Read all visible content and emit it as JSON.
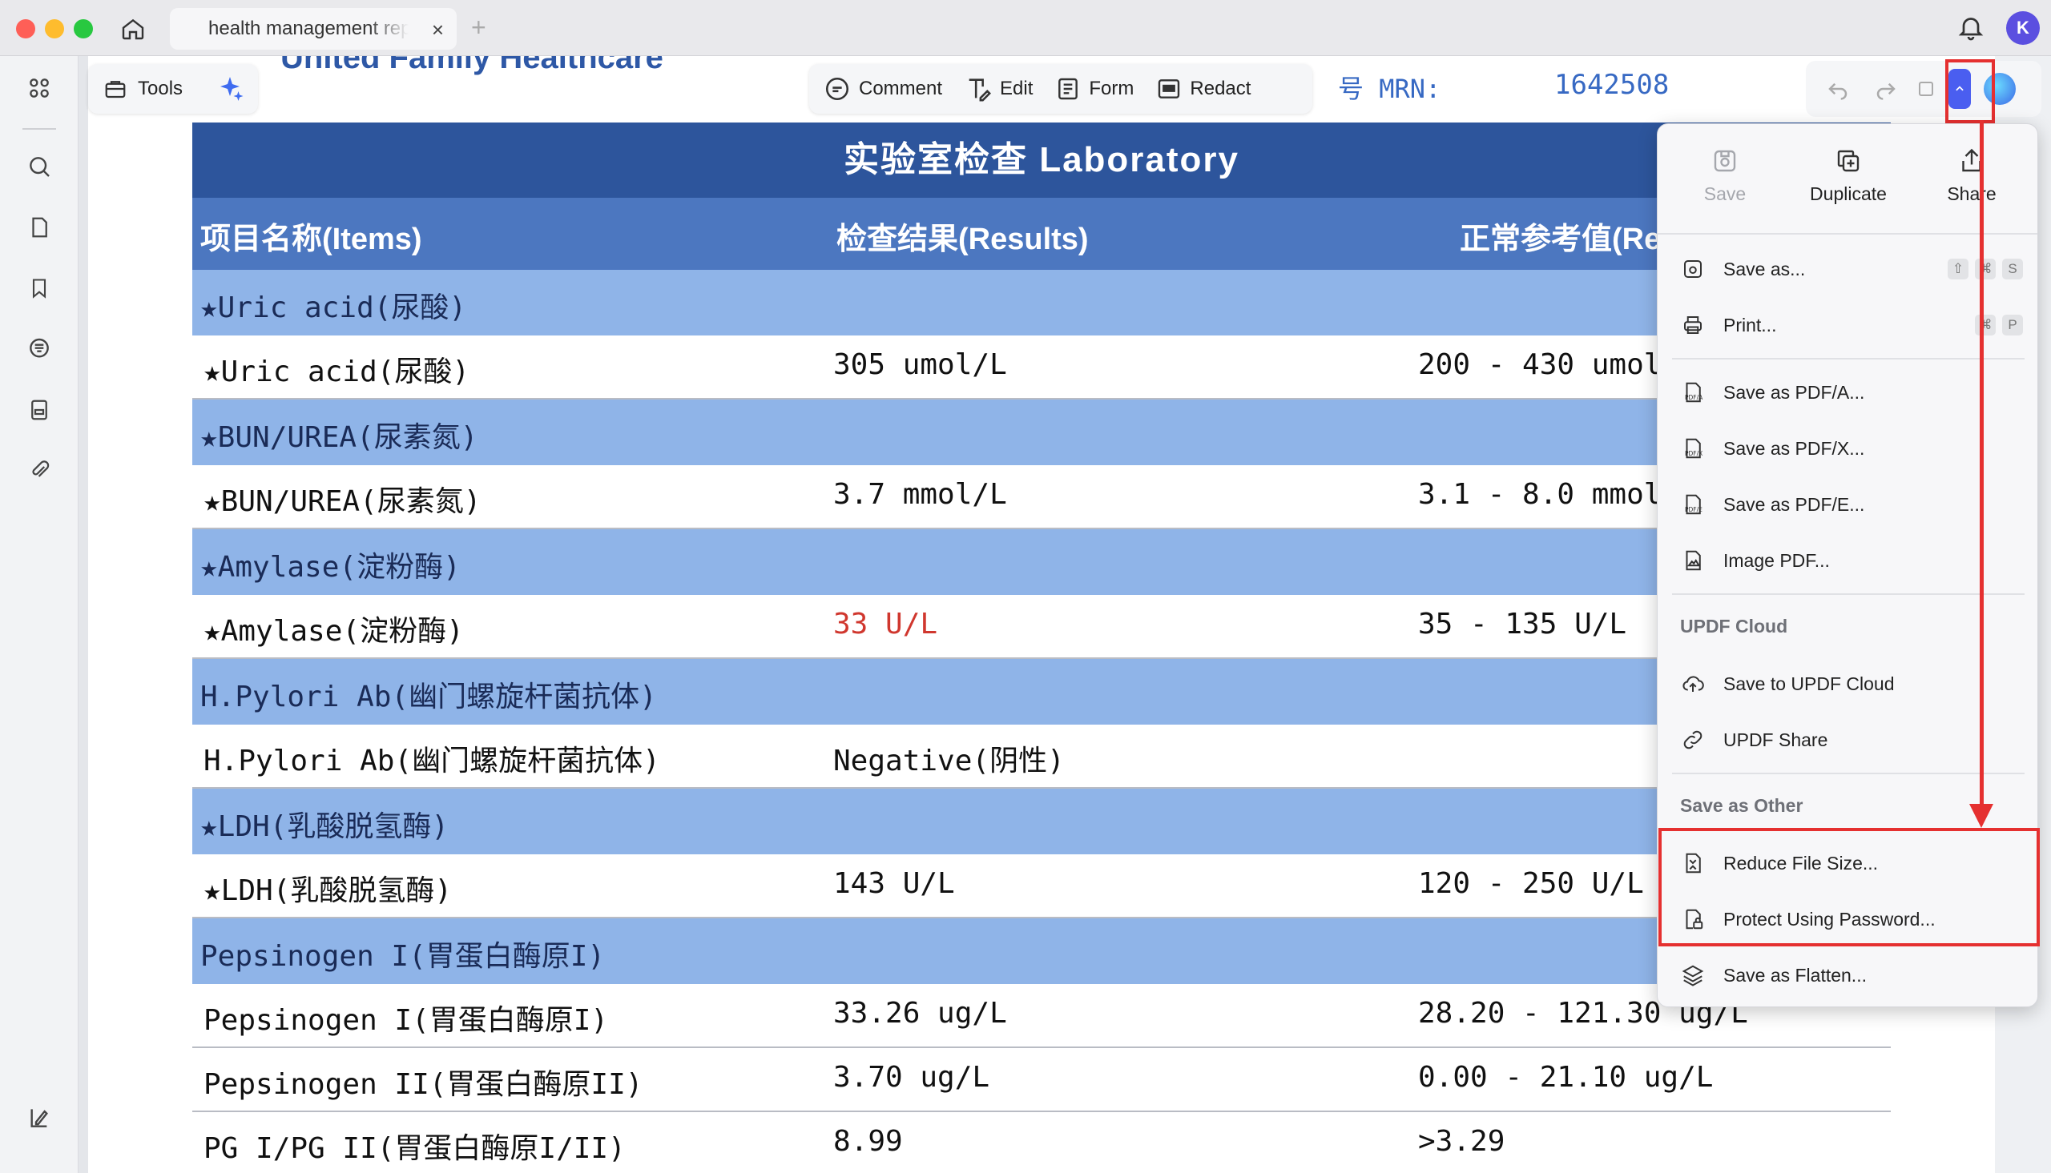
{
  "window": {
    "tab_title": "health management report",
    "tab_close": "×",
    "new_tab": "+",
    "avatar_initial": "K"
  },
  "toolbar": {
    "tools_label": "Tools",
    "comment_label": "Comment",
    "edit_label": "Edit",
    "form_label": "Form",
    "redact_label": "Redact"
  },
  "document": {
    "header_logo": "United Family Healthcare",
    "mrn_label": "号 MRN:",
    "mrn_value": "1642508",
    "table_title": "实验室检查 Laboratory",
    "columns": [
      "项目名称(Items)",
      "检查结果(Results)",
      "正常参考值(Re"
    ],
    "rows": [
      {
        "type": "group",
        "item": "★Uric acid(尿酸)"
      },
      {
        "type": "item",
        "item": "★Uric acid(尿酸)",
        "result": "305 umol/L",
        "reference": "200 - 430 umol/"
      },
      {
        "type": "group",
        "item": "★BUN/UREA(尿素氮)"
      },
      {
        "type": "item",
        "item": "★BUN/UREA(尿素氮)",
        "result": "3.7 mmol/L",
        "reference": "3.1 - 8.0 mmol/"
      },
      {
        "type": "group",
        "item": "★Amylase(淀粉酶)"
      },
      {
        "type": "item",
        "item": "★Amylase(淀粉酶)",
        "result": "33 U/L",
        "reference": "35 - 135 U/L",
        "abnormal": true
      },
      {
        "type": "group",
        "item": "H.Pylori Ab(幽门螺旋杆菌抗体)"
      },
      {
        "type": "item",
        "item": "H.Pylori Ab(幽门螺旋杆菌抗体)",
        "result": "Negative(阴性)",
        "reference": ""
      },
      {
        "type": "group",
        "item": "★LDH(乳酸脱氢酶)"
      },
      {
        "type": "item",
        "item": "★LDH(乳酸脱氢酶)",
        "result": "143 U/L",
        "reference": "120 - 250 U/L"
      },
      {
        "type": "group",
        "item": "Pepsinogen I(胃蛋白酶原I)"
      },
      {
        "type": "item",
        "item": "Pepsinogen I(胃蛋白酶原I)",
        "result": "33.26 ug/L",
        "reference": "28.20 - 121.30 ug/L"
      },
      {
        "type": "item",
        "item": "Pepsinogen II(胃蛋白酶原II)",
        "result": "3.70 ug/L",
        "reference": "0.00 - 21.10 ug/L"
      },
      {
        "type": "item",
        "item": "PG I/PG II(胃蛋白酶原I/II)",
        "result": "8.99",
        "reference": ">3.29"
      }
    ]
  },
  "menu": {
    "top_buttons": {
      "save": "Save",
      "duplicate": "Duplicate",
      "share": "Share"
    },
    "save_as": "Save as...",
    "save_as_shortcut": [
      "⇧",
      "⌘",
      "S"
    ],
    "print": "Print...",
    "print_shortcut": [
      "⌘",
      "P"
    ],
    "save_pdfa": "Save as PDF/A...",
    "save_pdfx": "Save as PDF/X...",
    "save_pdfe": "Save as PDF/E...",
    "image_pdf": "Image PDF...",
    "section_cloud": "UPDF Cloud",
    "save_cloud": "Save to UPDF Cloud",
    "updf_share": "UPDF Share",
    "section_other": "Save as Other",
    "reduce_size": "Reduce File Size...",
    "protect_password": "Protect Using Password...",
    "save_flatten": "Save as Flatten..."
  },
  "colors": {
    "accent": "#4a5ef0",
    "table_title_bg": "#2d559c",
    "table_head_bg": "#4c77c0",
    "group_row_bg": "#8fb4e8",
    "abnormal": "#d0372e",
    "annotation_red": "#e53030"
  }
}
